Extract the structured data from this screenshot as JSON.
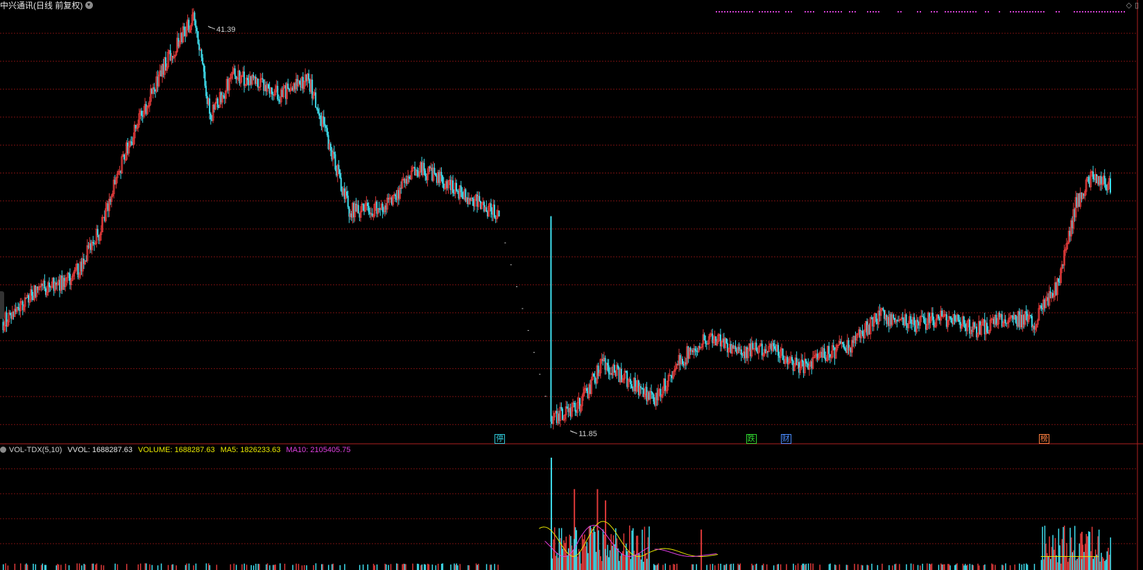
{
  "header": {
    "title": "中兴通讯(日线 前复权)"
  },
  "volume_header": {
    "name": "VOL-TDX(5,10)",
    "vvol": "VVOL: 1688287.63",
    "volume": "VOLUME: 1688287.63",
    "ma5": "MA5: 1826233.63",
    "ma10": "MA10: 2105405.75"
  },
  "annotations": {
    "high_label": "41.39",
    "low_label": "11.85"
  },
  "badges": [
    {
      "text": "停",
      "color": "#30c8d8"
    },
    {
      "text": "跌",
      "color": "#30d830"
    },
    {
      "text": "财",
      "color": "#4a8cff"
    },
    {
      "text": "榜",
      "color": "#ff8040"
    }
  ],
  "colors": {
    "up": "#e03a3a",
    "down": "#40e0f0",
    "grid": "#7a1010",
    "background": "#000000",
    "ma5": "#e8e800",
    "ma10": "#e040e0",
    "dots": "#d040d0"
  },
  "chart_data": {
    "type": "candlestick",
    "symbol": "中兴通讯",
    "period": "日线 前复权",
    "high": 41.39,
    "low": 11.85,
    "y_range": [
      10.9,
      42.4
    ],
    "segments": [
      {
        "name": "rally",
        "points": [
          [
            0,
            19.8
          ],
          [
            30,
            22.2
          ],
          [
            60,
            22.9
          ],
          [
            85,
            26.6
          ],
          [
            105,
            32.0
          ],
          [
            140,
            38.6
          ],
          [
            165,
            42.0
          ],
          [
            180,
            34.8
          ],
          [
            200,
            37.9
          ],
          [
            240,
            36.4
          ],
          [
            265,
            37.4
          ],
          [
            280,
            33.6
          ],
          [
            300,
            27.9
          ],
          [
            330,
            28.1
          ],
          [
            360,
            31.0
          ],
          [
            385,
            30.0
          ],
          [
            400,
            29.1
          ],
          [
            430,
            27.6
          ]
        ]
      },
      {
        "name": "halt_drift",
        "points": [
          [
            430,
            27.2
          ],
          [
            475,
            12.8
          ]
        ]
      },
      {
        "name": "bottom_recovery",
        "points": [
          [
            475,
            12.6
          ],
          [
            500,
            13.8
          ],
          [
            520,
            16.8
          ],
          [
            545,
            15.3
          ],
          [
            565,
            14.0
          ],
          [
            585,
            16.8
          ],
          [
            610,
            18.7
          ],
          [
            640,
            17.7
          ],
          [
            665,
            17.9
          ],
          [
            690,
            16.4
          ],
          [
            710,
            17.4
          ],
          [
            735,
            18.1
          ],
          [
            760,
            20.3
          ],
          [
            790,
            19.6
          ],
          [
            815,
            20.1
          ],
          [
            845,
            19.2
          ],
          [
            865,
            20.0
          ],
          [
            885,
            20.0
          ],
          [
            895,
            19.8
          ]
        ]
      },
      {
        "name": "breakout",
        "points": [
          [
            895,
            20.0
          ],
          [
            915,
            22.6
          ],
          [
            930,
            28.4
          ],
          [
            945,
            30.5
          ],
          [
            960,
            29.7
          ]
        ]
      }
    ],
    "halt_gap": {
      "from_index": 430,
      "to_index": 475
    },
    "markers": [
      {
        "label": "停",
        "index": 430
      },
      {
        "label": "跌",
        "index": 648
      },
      {
        "label": "财",
        "index": 678
      },
      {
        "label": "榜",
        "index": 902
      }
    ],
    "volume": {
      "last": 1688287.63,
      "ma5_last": 1826233.63,
      "ma10_last": 2105405.75,
      "spikes": [
        {
          "index": 475,
          "level": 1.0
        },
        {
          "index": 495,
          "level": 0.72
        },
        {
          "index": 515,
          "level": 0.72
        },
        {
          "index": 522,
          "level": 0.62
        },
        {
          "index": 605,
          "level": 0.36
        },
        {
          "index": 935,
          "level": 0.34
        },
        {
          "index": 940,
          "level": 0.3
        }
      ]
    }
  }
}
